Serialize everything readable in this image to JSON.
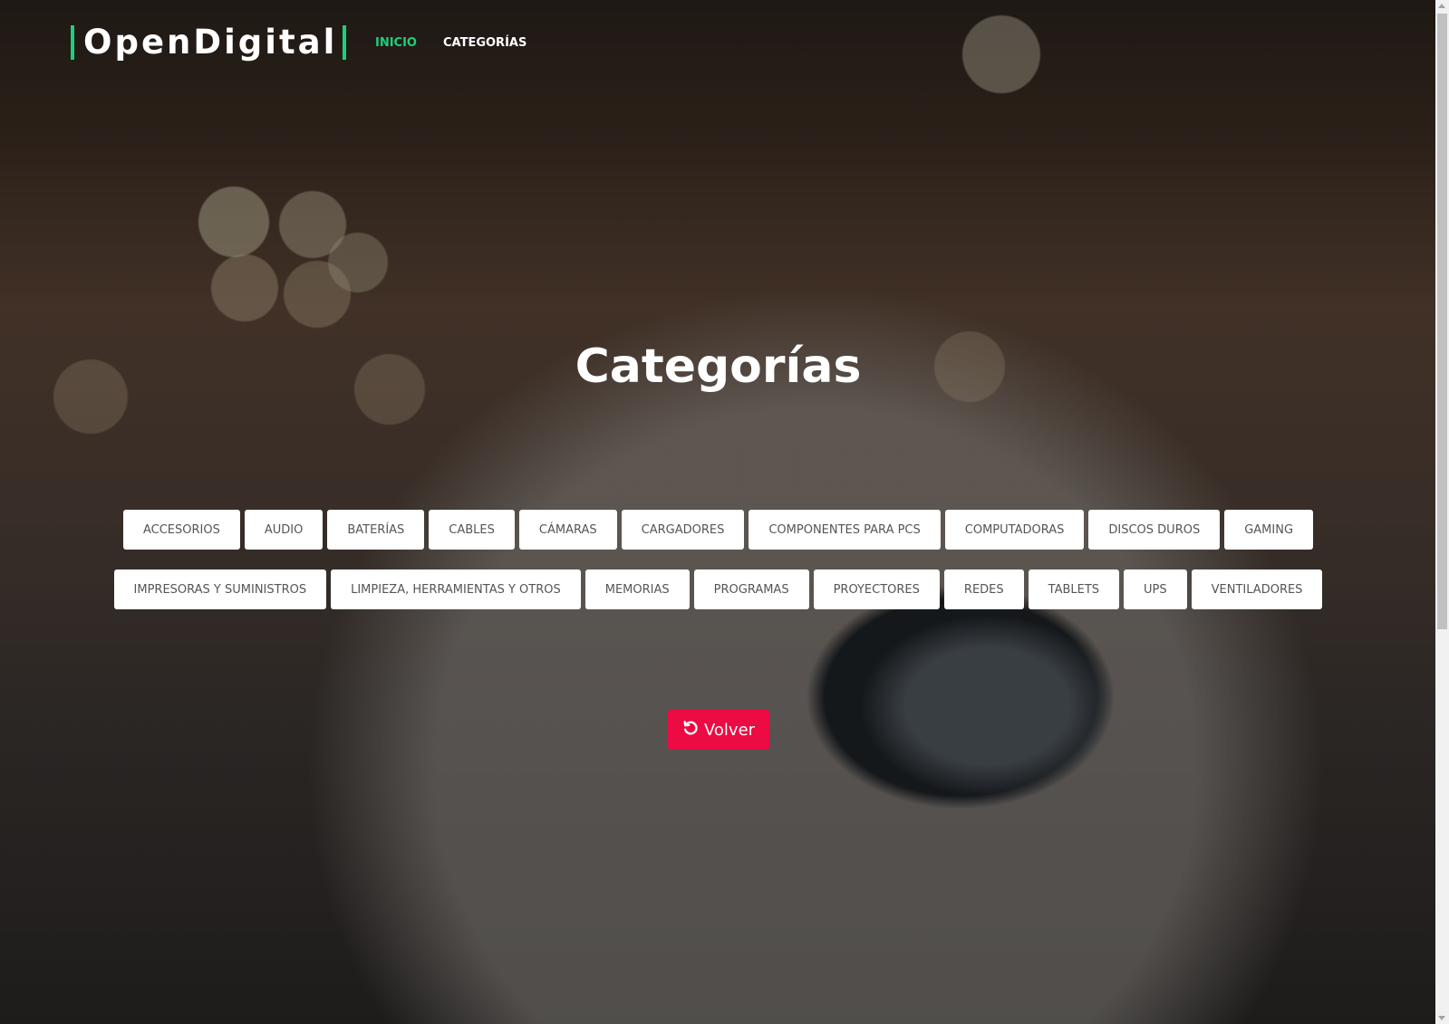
{
  "brand": "OpenDigital",
  "nav": {
    "inicio": "INICIO",
    "categorias": "CATEGORÍAS"
  },
  "page_title": "Categorías",
  "categories_row1": [
    "ACCESORIOS",
    "AUDIO",
    "BATERÍAS",
    "CABLES",
    "CÁMARAS",
    "CARGADORES",
    "COMPONENTES PARA PCS",
    "COMPUTADORAS",
    "DISCOS DUROS",
    "GAMING"
  ],
  "categories_row2": [
    "IMPRESORAS Y SUMINISTROS",
    "LIMPIEZA, HERRAMIENTAS Y OTROS",
    "MEMORIAS",
    "PROGRAMAS",
    "PROYECTORES",
    "REDES",
    "TABLETS",
    "UPS",
    "VENTILADORES"
  ],
  "back_button": {
    "label": "Volver",
    "icon": "undo-icon"
  },
  "colors": {
    "accent": "#1bd07a",
    "danger": "#ec0b43"
  }
}
